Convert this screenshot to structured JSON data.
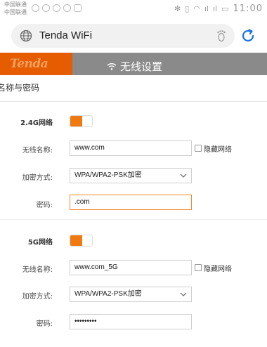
{
  "status_bar": {
    "carrier_1": "中国联通",
    "carrier_2": "中国联通",
    "time": "11:00",
    "bluetooth_glyph": "✻",
    "vibrate_glyph": "▯",
    "wifi_glyph": "◠",
    "signal_1": "ıl",
    "signal_2": "ıl",
    "battery_glyph": "▭"
  },
  "browser": {
    "url_text": "Tenda WiFi"
  },
  "header": {
    "logo": "Tenda",
    "title": "无线设置"
  },
  "section": {
    "title": "名称与密码"
  },
  "band_24": {
    "label": "2.4G网络",
    "enabled": true,
    "ssid_label": "无线名称:",
    "ssid_value": "www.com",
    "hide_label": "隐藏网络",
    "hide_checked": false,
    "security_label": "加密方式:",
    "security_value": "WPA/WPA2-PSK加密",
    "password_label": "密码:",
    "password_value": ".com"
  },
  "band_5": {
    "label": "5G网络",
    "enabled": true,
    "ssid_label": "无线名称:",
    "ssid_value": "www.com_5G",
    "hide_label": "隐藏网络",
    "hide_checked": false,
    "security_label": "加密方式:",
    "security_value": "WPA/WPA2-PSK加密",
    "password_label": "密码:",
    "password_value": "•••••••••"
  },
  "colors": {
    "accent": "#f07a10",
    "logo_bg": "#e65c00",
    "header_bg": "#8a8a8a"
  }
}
